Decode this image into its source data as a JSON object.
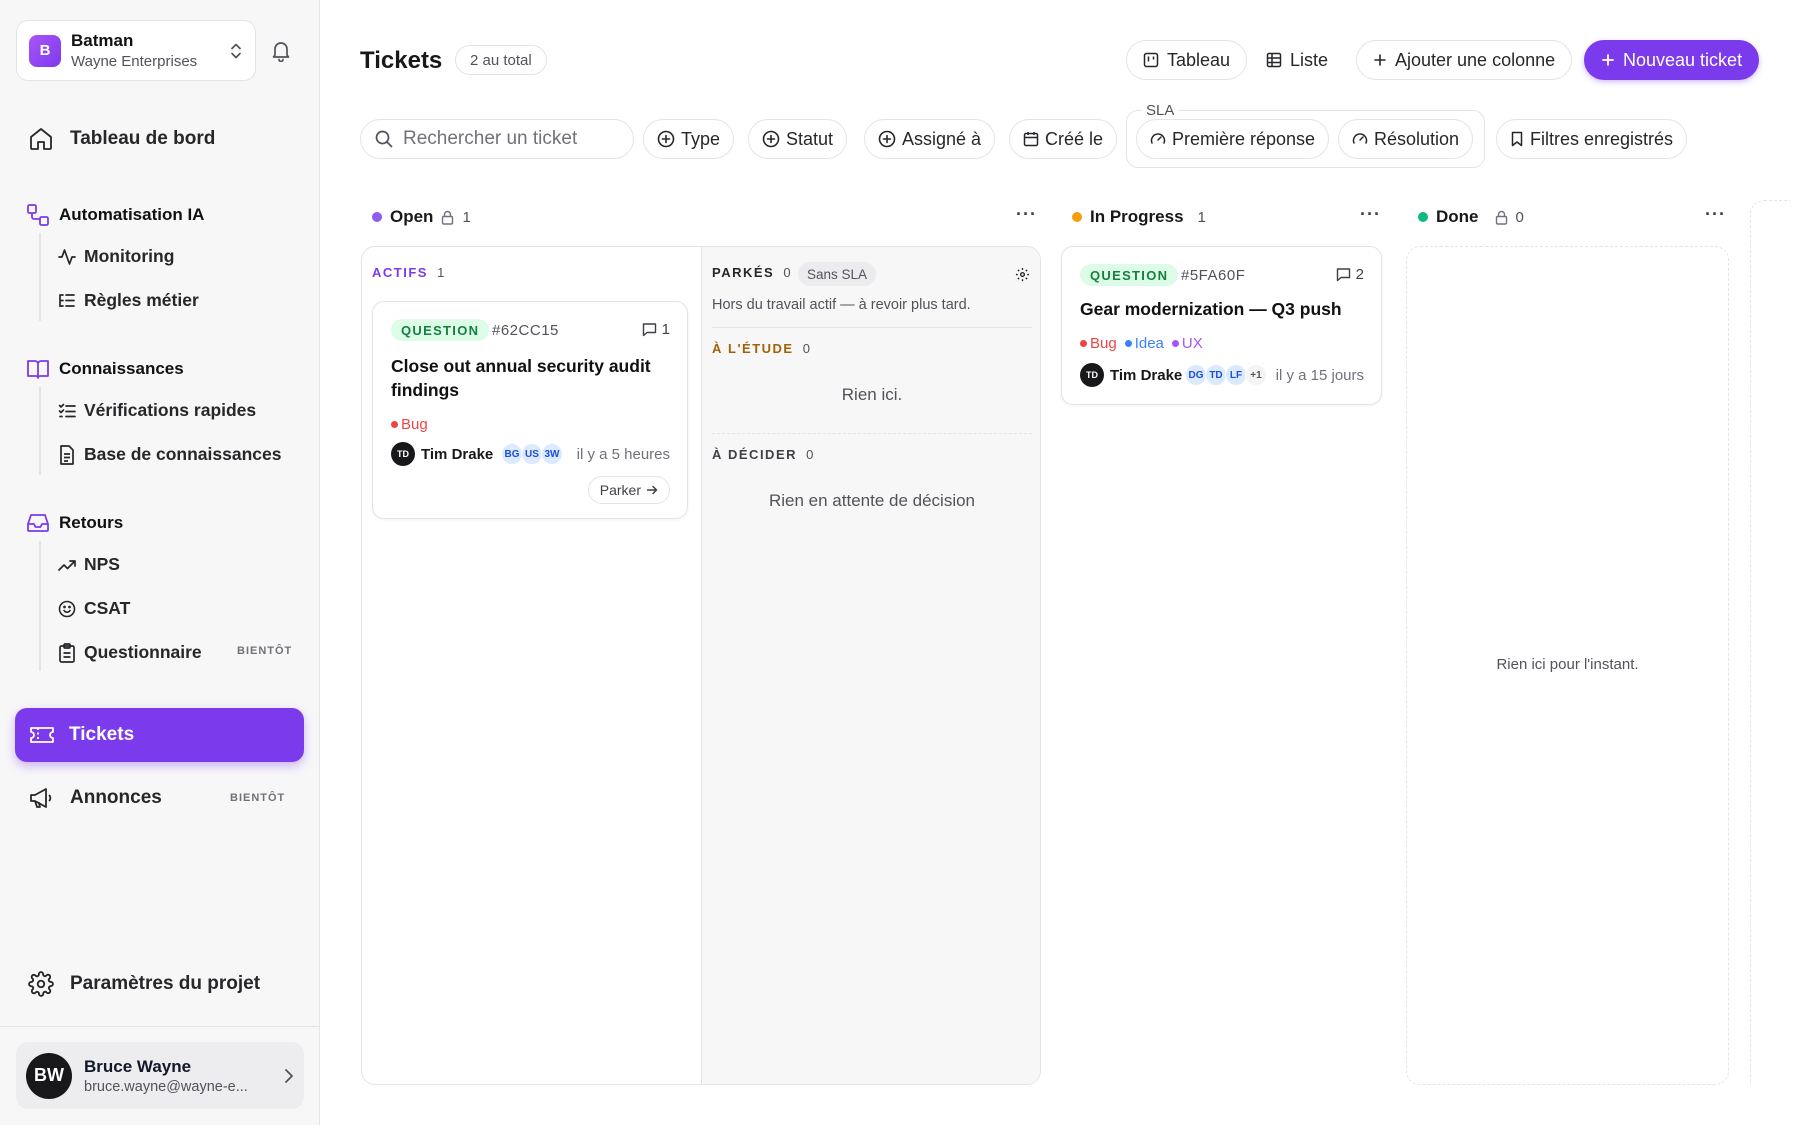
{
  "org": {
    "initial": "B",
    "name": "Batman",
    "company": "Wayne Enterprises"
  },
  "nav": {
    "dashboard": "Tableau de bord",
    "sections": [
      {
        "label": "Automatisation IA",
        "items": [
          {
            "label": "Monitoring"
          },
          {
            "label": "Règles métier"
          }
        ]
      },
      {
        "label": "Connaissances",
        "items": [
          {
            "label": "Vérifications rapides"
          },
          {
            "label": "Base de connaissances"
          }
        ]
      },
      {
        "label": "Retours",
        "items": [
          {
            "label": "NPS"
          },
          {
            "label": "CSAT"
          },
          {
            "label": "Questionnaire",
            "badge": "BIENTÔT"
          }
        ]
      }
    ],
    "tickets": "Tickets",
    "announcements": "Annonces",
    "announcements_badge": "BIENTÔT",
    "settings": "Paramètres du projet"
  },
  "user": {
    "initials": "BW",
    "name": "Bruce Wayne",
    "email": "bruce.wayne@wayne-e..."
  },
  "header": {
    "title": "Tickets",
    "total": "2 au total",
    "view_board": "Tableau",
    "view_list": "Liste",
    "add_column": "Ajouter une colonne",
    "new_ticket": "Nouveau ticket"
  },
  "filters": {
    "search_placeholder": "Rechercher un ticket",
    "type": "Type",
    "status": "Statut",
    "assignee": "Assigné à",
    "created": "Créé le",
    "sla_label": "SLA",
    "first_response": "Première réponse",
    "resolution": "Résolution",
    "saved": "Filtres enregistrés"
  },
  "columns": {
    "open": {
      "name": "Open",
      "count": "1",
      "color": "#8b5cf6",
      "active_label": "ACTIFS",
      "active_count": "1",
      "parked_label": "PARKÉS",
      "parked_count": "0",
      "sla_badge": "Sans SLA",
      "parked_hint": "Hors du travail actif — à revoir plus tard.",
      "study_label": "À L'ÉTUDE",
      "study_count": "0",
      "study_empty": "Rien ici.",
      "decide_label": "À DÉCIDER",
      "decide_count": "0",
      "decide_empty": "Rien en attente de décision"
    },
    "in_progress": {
      "name": "In Progress",
      "count": "1",
      "color": "#f59e0b"
    },
    "done": {
      "name": "Done",
      "count": "0",
      "color": "#10b981",
      "empty": "Rien ici pour l'instant."
    }
  },
  "cards": {
    "card1": {
      "type": "QUESTION",
      "id": "#62CC15",
      "comments": "1",
      "title": "Close out annual security audit findings",
      "tags": [
        {
          "label": "Bug",
          "color": "#ef4444"
        }
      ],
      "assignee_initials": "TD",
      "assignee": "Tim Drake",
      "watchers": [
        "BG",
        "US",
        "3W"
      ],
      "time": "il y a 5 heures",
      "park_label": "Parker"
    },
    "card2": {
      "type": "QUESTION",
      "id": "#5FA60F",
      "comments": "2",
      "title": "Gear modernization — Q3 push",
      "tags": [
        {
          "label": "Bug",
          "color": "#ef4444"
        },
        {
          "label": "Idea",
          "color": "#3b82f6"
        },
        {
          "label": "UX",
          "color": "#a855f7"
        }
      ],
      "assignee_initials": "TD",
      "assignee": "Tim Drake",
      "watchers": [
        "DG",
        "TD",
        "LF",
        "+1"
      ],
      "time": "il y a 15 jours"
    }
  },
  "colors": {
    "accent": "#7c3aed",
    "question_badge_bg": "#dcfce7",
    "question_badge_fg": "#15803d"
  }
}
